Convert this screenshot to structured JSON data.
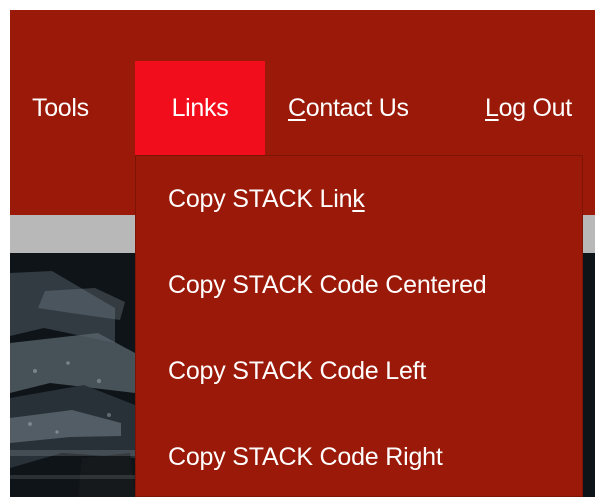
{
  "nav": {
    "items": [
      {
        "label": "Tools"
      },
      {
        "label": "Links"
      },
      {
        "label_prefix": "",
        "label_underlined": "C",
        "label_suffix": "ontact Us"
      },
      {
        "label_prefix": "",
        "label_underlined": "L",
        "label_suffix": "og Out"
      }
    ]
  },
  "links_menu": {
    "items": [
      {
        "label_prefix": "Copy STACK Lin",
        "label_underlined": "k",
        "label_suffix": ""
      },
      {
        "label": "Copy STACK Code Centered"
      },
      {
        "label": "Copy STACK Code Left"
      },
      {
        "label": "Copy STACK Code Right"
      }
    ]
  },
  "colors": {
    "header": "#9a1908",
    "active_tab": "#f20d1c",
    "menu_bg": "#9a1908",
    "strip": "#b8b8b8"
  }
}
